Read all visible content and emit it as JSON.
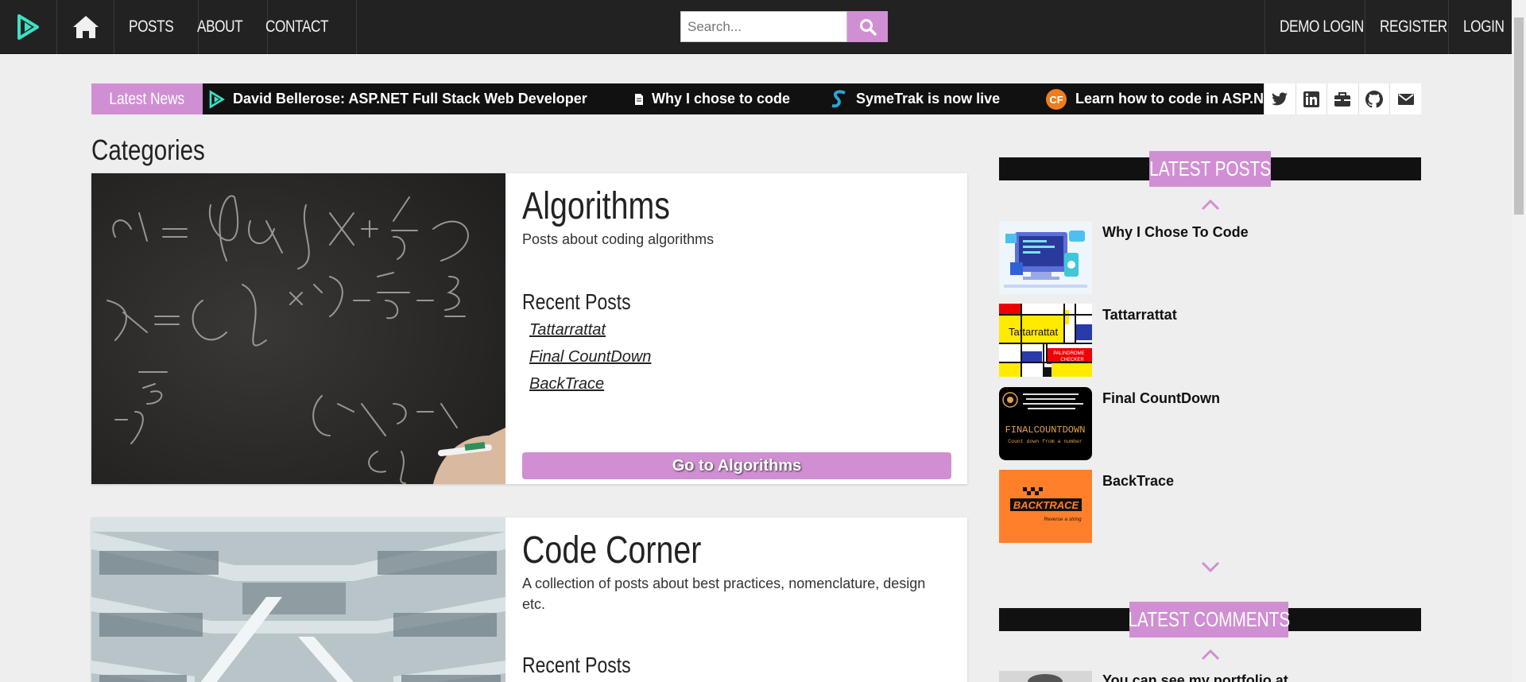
{
  "nav": {
    "links": [
      "POSTS",
      "ABOUT",
      "CONTACT"
    ],
    "search_placeholder": "Search...",
    "right_links": [
      "DEMO LOGIN",
      "REGISTER",
      "LOGIN"
    ]
  },
  "ticker": {
    "label": "Latest News",
    "items": [
      "David Bellerose: ASP.NET Full Stack Web Developer",
      "Why I chose to code",
      "SymeTrak is now live",
      "Learn how to code in ASP.NET"
    ]
  },
  "categories": {
    "title": "Categories",
    "cards": [
      {
        "title": "Algorithms",
        "description": "Posts about coding algorithms",
        "recent_label": "Recent Posts",
        "recent_posts": [
          "Tattarrattat",
          "Final CountDown",
          "BackTrace"
        ],
        "button": "Go to Algorithms"
      },
      {
        "title": "Code Corner",
        "description": "A collection of posts about best practices, nomenclature, design etc.",
        "recent_label": "Recent Posts"
      }
    ]
  },
  "sidebar": {
    "latest_posts_label": "LATEST POSTS",
    "latest_comments_label": "LATEST COMMENTS",
    "posts": [
      {
        "title": "Why I Chose To Code"
      },
      {
        "title": "Tattarrattat"
      },
      {
        "title": "Final CountDown"
      },
      {
        "title": "BackTrace"
      }
    ],
    "comment_preview": "You can see my portfolio at",
    "thumb_texts": {
      "tattarrattat": "Tattarrattat",
      "palindrome": "PALINDROME CHECKER",
      "countdown": "FINALCOUNTDOWN",
      "countdown_sub": "Count down from a number",
      "backtrace": "BACKTRACE",
      "backtrace_sub": "Reverse a string"
    }
  },
  "colors": {
    "accent": "#d18fd3",
    "nav_bg": "#222222",
    "brand_teal": "#3fe0c5",
    "ticker_bg": "#111111"
  },
  "icons": [
    "logo-icon",
    "home-icon",
    "search-icon",
    "twitter-icon",
    "linkedin-icon",
    "briefcase-icon",
    "github-icon",
    "mail-icon",
    "chevron-up-icon",
    "chevron-down-icon"
  ]
}
